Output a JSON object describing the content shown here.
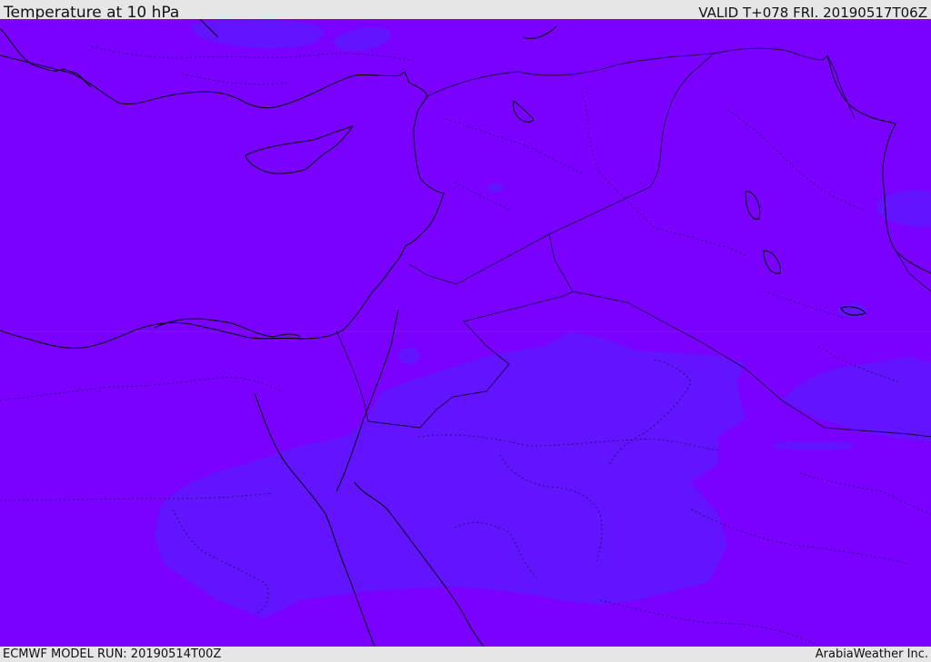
{
  "header": {
    "title": "Temperature at 10 hPa",
    "valid_time": "VALID T+078 FRI. 20190517T06Z"
  },
  "footer": {
    "model_run": "ECMWF MODEL RUN: 20190514T00Z",
    "credit": "ArabiaWeather Inc."
  },
  "map": {
    "field_colors": {
      "background": "#7a00ff",
      "warmer_zone": "#6314ff",
      "coastline": "#000000",
      "border": "#1a0040"
    }
  }
}
